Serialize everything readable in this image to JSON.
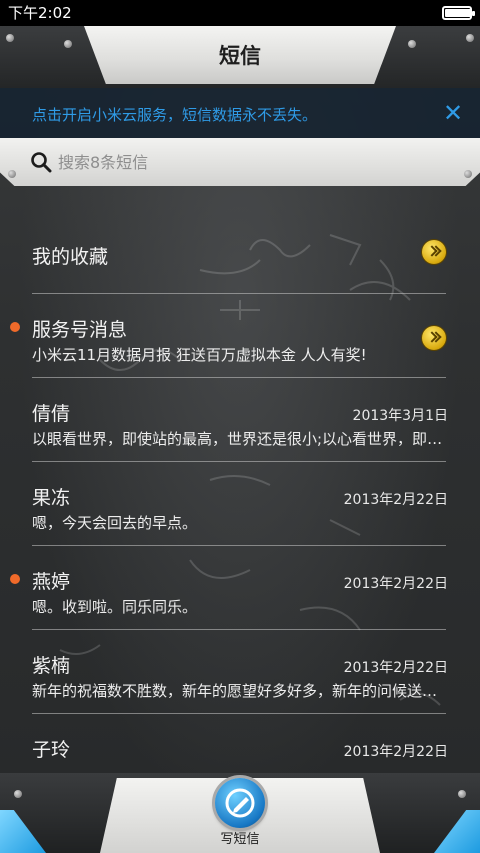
{
  "status_bar": {
    "time": "下午2:02",
    "battery_level": 1.0
  },
  "header": {
    "title": "短信"
  },
  "notice": {
    "text": "点击开启小米云服务，短信数据永不丢失。",
    "close_icon": "close-icon"
  },
  "search": {
    "placeholder": "搜索8条短信"
  },
  "threads": [
    {
      "name": "我的收藏",
      "preview": "",
      "date": "",
      "unread": false,
      "arrow": true
    },
    {
      "name": "服务号消息",
      "preview": "小米云11月数据月报 狂送百万虚拟本金 人人有奖!",
      "date": "",
      "unread": true,
      "arrow": true
    },
    {
      "name": "倩倩",
      "preview": "以眼看世界，即使站的最高，世界还是很小;以心看世界，即使站的最低，世界也是很大。",
      "date": "2013年3月1日",
      "unread": false,
      "arrow": false
    },
    {
      "name": "果冻",
      "preview": "嗯，今天会回去的早点。",
      "date": "2013年2月22日",
      "unread": false,
      "arrow": false
    },
    {
      "name": "燕婷",
      "preview": "嗯。收到啦。同乐同乐。",
      "date": "2013年2月22日",
      "unread": true,
      "arrow": false
    },
    {
      "name": "紫楠",
      "preview": "新年的祝福数不胜数，新年的愿望好多好多，新年的问候送给你。",
      "date": "2013年2月22日",
      "unread": false,
      "arrow": false
    },
    {
      "name": "子玲",
      "preview": "",
      "date": "2013年2月22日",
      "unread": false,
      "arrow": false
    }
  ],
  "bottom": {
    "compose_label": "写短信"
  },
  "colors": {
    "accent_blue": "#2f9be6",
    "unread_dot": "#f06a2a",
    "arrow_gold": "#e0b316"
  }
}
